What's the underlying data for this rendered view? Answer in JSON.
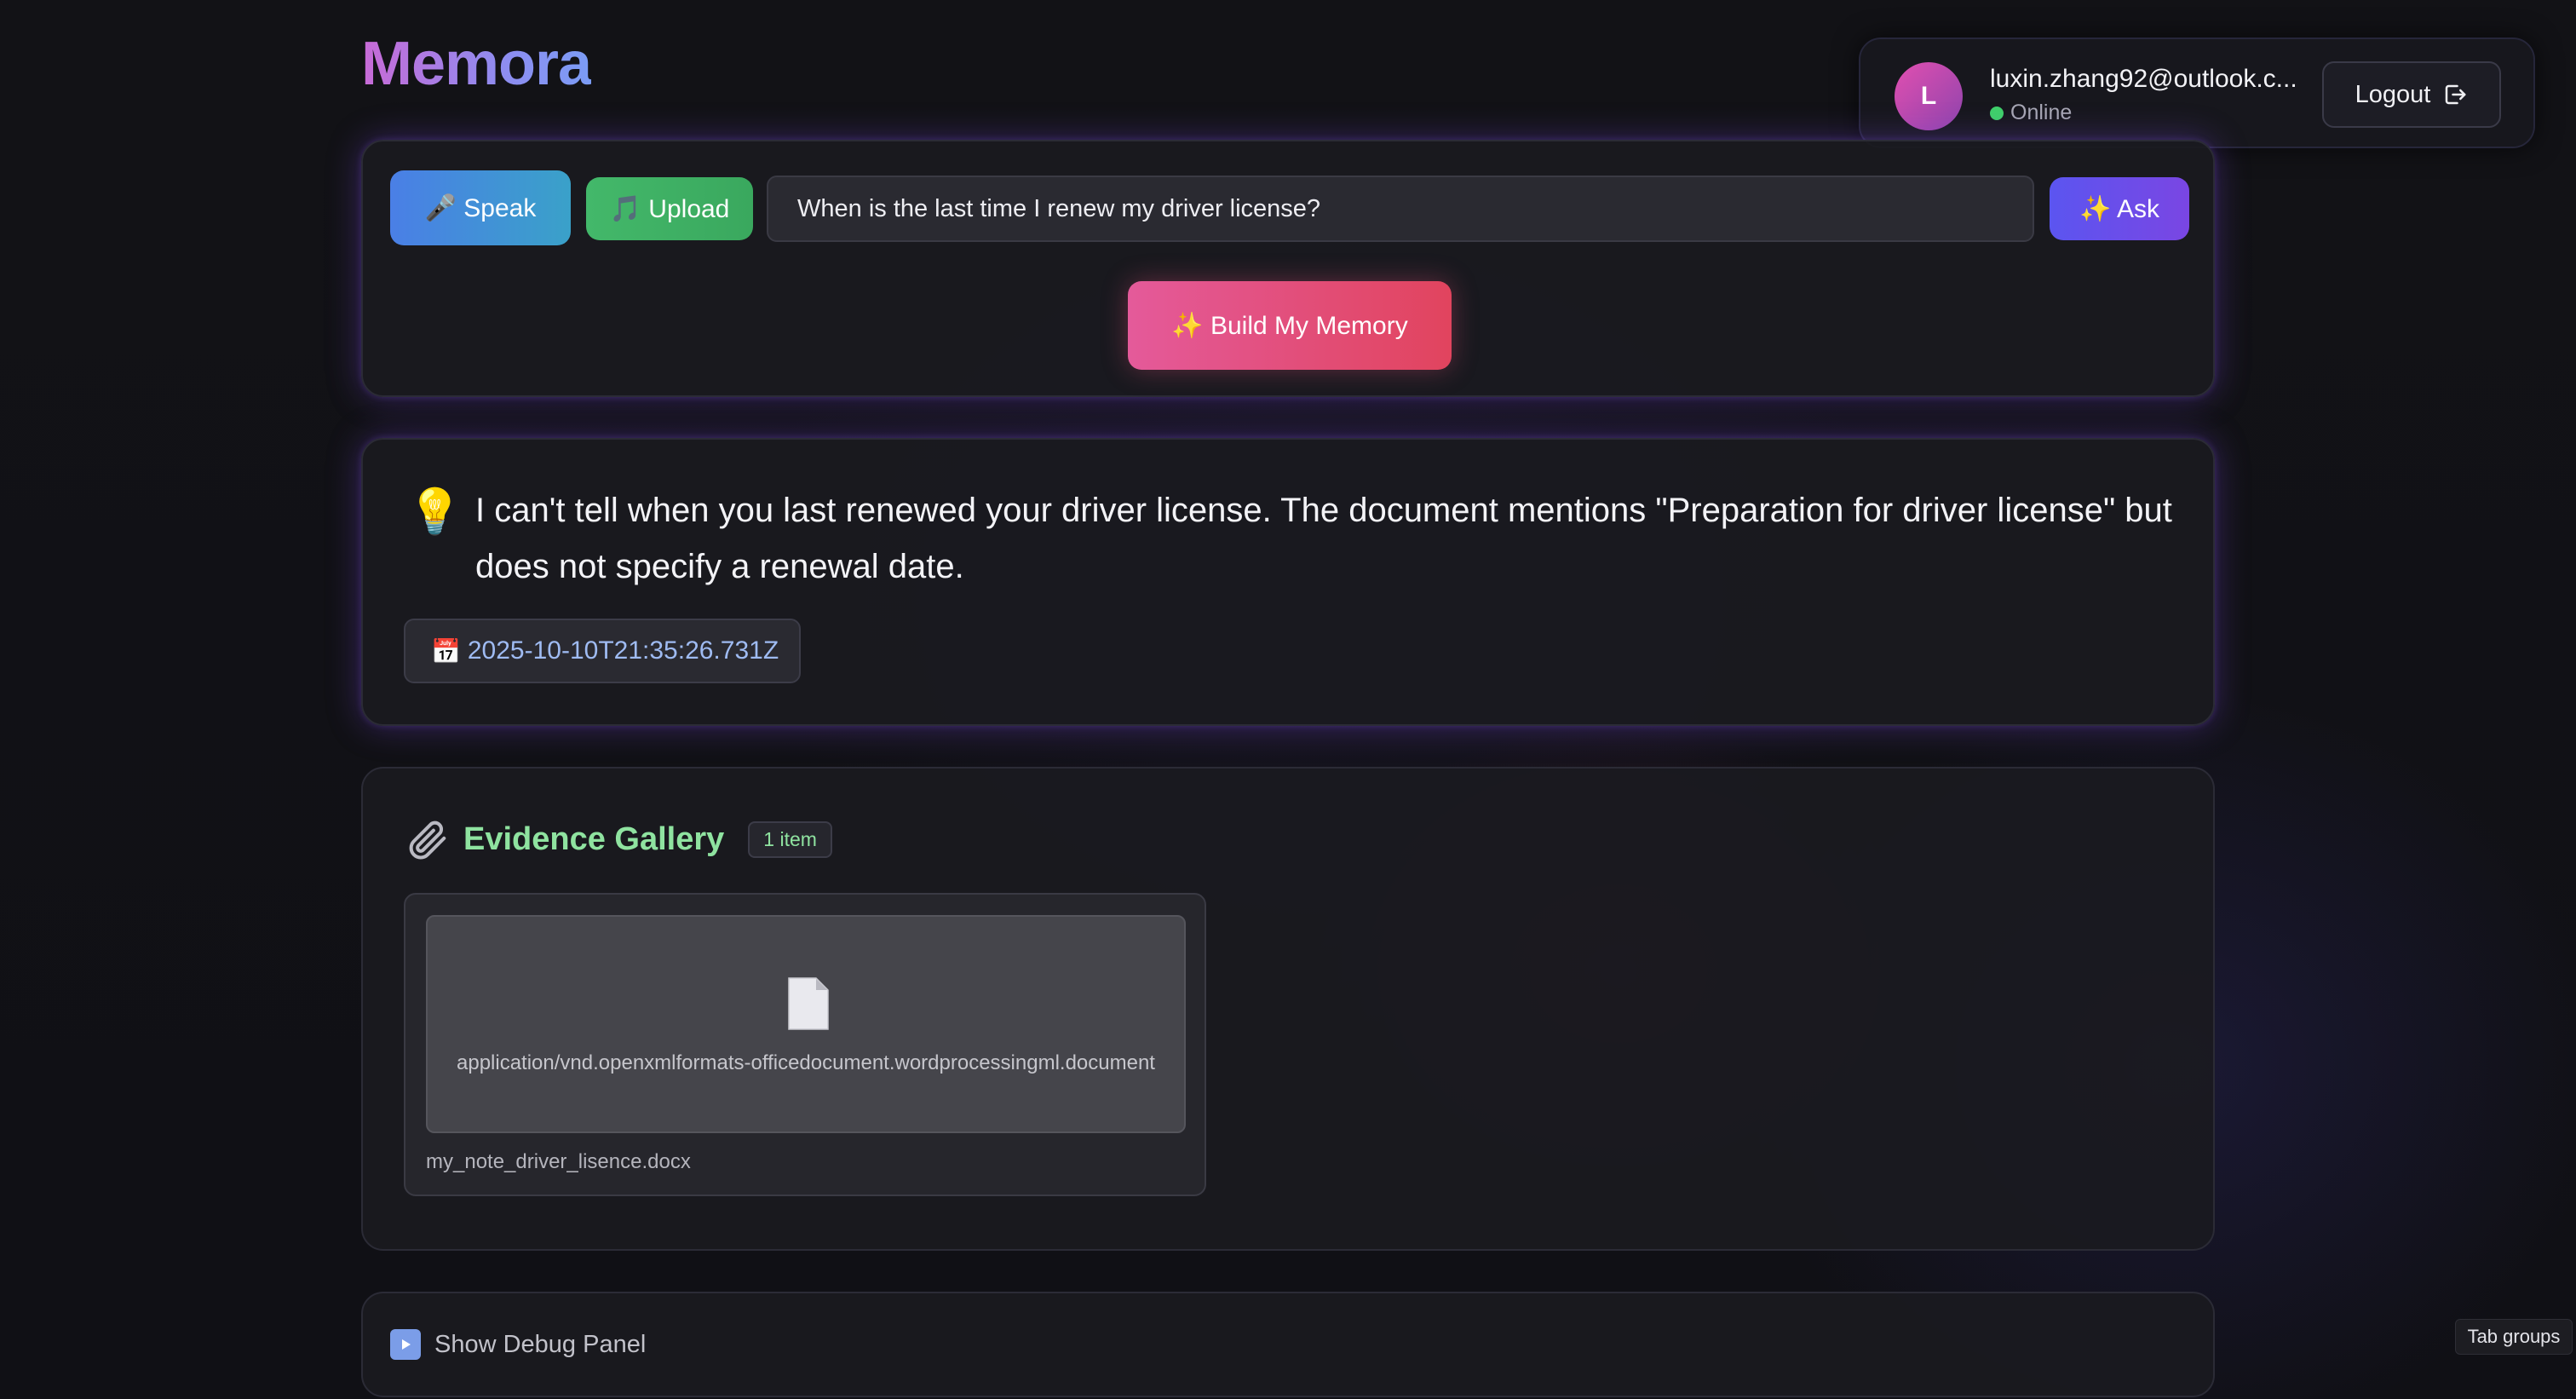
{
  "app": {
    "title": "Memora"
  },
  "user": {
    "avatar_initial": "L",
    "email": "luxin.zhang92@outlook.c...",
    "status": "Online",
    "logout_label": "Logout"
  },
  "query_bar": {
    "speak_label": "🎤 Speak",
    "upload_label": "🎵 Upload",
    "query_value": "When is the last time I renew my driver license?",
    "ask_label": "✨ Ask",
    "build_label": "✨  Build My Memory"
  },
  "answer": {
    "icon": "lightbulb-icon",
    "text": "I can't tell when you last renewed your driver license. The document mentions \"Preparation for driver license\" but does not specify a renewal date.",
    "date_icon": "📅",
    "date": "2025-10-10T21:35:26.731Z"
  },
  "evidence": {
    "title": "Evidence Gallery",
    "count_badge": "1 item",
    "items": [
      {
        "mime": "application/vnd.openxmlformats-officedocument.wordprocessingml.document",
        "file_name": "my_note_driver_lisence.docx"
      }
    ]
  },
  "debug": {
    "label": "Show Debug Panel"
  },
  "browser": {
    "tab_groups_label": "Tab groups"
  },
  "colors": {
    "accent_green": "#8fe3a0",
    "accent_purple": "#7a46e3",
    "accent_pink": "#e45a9a",
    "online": "#3fd16a"
  }
}
